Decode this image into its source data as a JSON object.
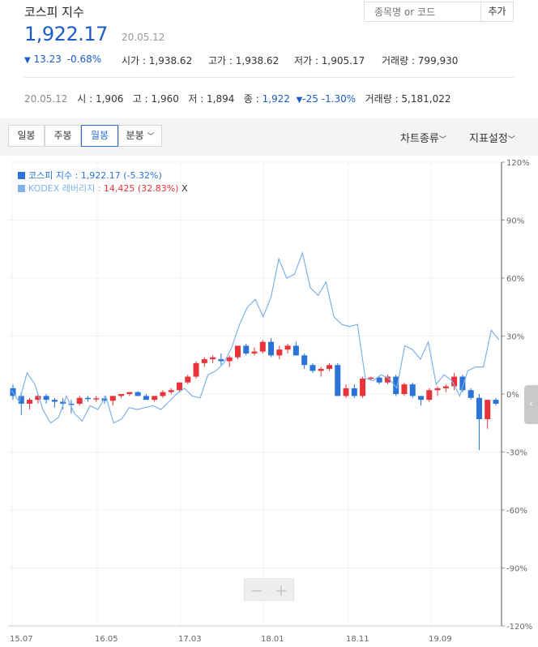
{
  "header": {
    "title": "코스피 지수",
    "price": "1,922.17",
    "date": "20.05.12",
    "change_arrow": "▼",
    "change": "13.23",
    "change_pct": "-0.68%",
    "stats": [
      {
        "label": "시가",
        "value": "1,938.62"
      },
      {
        "label": "고가",
        "value": "1,938.62"
      },
      {
        "label": "저가",
        "value": "1,905.17"
      },
      {
        "label": "거래량",
        "value": "799,930"
      }
    ],
    "search_placeholder": "종목명 or 코드",
    "add_label": "추가"
  },
  "daily": {
    "date": "20.05.12",
    "open_label": "시",
    "open": "1,906",
    "high_label": "고",
    "high": "1,960",
    "low_label": "저",
    "low": "1,894",
    "close_label": "종",
    "close": "1,922",
    "arrow": "▼",
    "change": "-25",
    "change_pct": "-1.30%",
    "volume_label": "거래량",
    "volume": "5,181,022"
  },
  "toolbar": {
    "tabs": [
      "일봉",
      "주봉",
      "월봉",
      "분봉"
    ],
    "selected": "월봉",
    "chart_type": "차트종류",
    "indicator": "지표설정"
  },
  "legend": {
    "s1_name": "코스피 지수",
    "s1_value": "1,922.17",
    "s1_pct": "(-5.32%)",
    "s2_name": "KODEX 레버리지",
    "s2_value": "14,425",
    "s2_pct": "(32.83%)",
    "s2_close": "X"
  },
  "colors": {
    "up": "#e8333a",
    "down": "#2a73d9",
    "line": "#7fb2e8",
    "accent": "#1a5bc6"
  },
  "chart_data": {
    "type": "line",
    "x_ticks": [
      "15.07",
      "16.05",
      "17.03",
      "18.01",
      "18.11",
      "19.09"
    ],
    "y_ticks": [
      "120%",
      "90%",
      "60%",
      "30%",
      "0%",
      "-30%",
      "-60%",
      "-90%",
      "-120%"
    ],
    "ylim": [
      -120,
      120
    ],
    "candles": [
      {
        "o": 3,
        "h": 5,
        "l": -3,
        "c": -1
      },
      {
        "o": -1,
        "h": 1,
        "l": -11,
        "c": -5
      },
      {
        "o": -5,
        "h": -2,
        "l": -8,
        "c": -3
      },
      {
        "o": -3,
        "h": 0,
        "l": -5,
        "c": -1
      },
      {
        "o": -1,
        "h": 0,
        "l": -5,
        "c": -3
      },
      {
        "o": -3,
        "h": -2,
        "l": -7,
        "c": -4
      },
      {
        "o": -4,
        "h": -2,
        "l": -8,
        "c": -5
      },
      {
        "o": -5,
        "h": -3,
        "l": -10,
        "c": -5.5
      },
      {
        "o": -5,
        "h": -1,
        "l": -6,
        "c": -2
      },
      {
        "o": -2,
        "h": -1,
        "l": -4,
        "c": -2.5
      },
      {
        "o": -2.5,
        "h": -1,
        "l": -4,
        "c": -2.2
      },
      {
        "o": -2.2,
        "h": -1,
        "l": -5,
        "c": -3.5
      },
      {
        "o": -3.5,
        "h": -2,
        "l": -6,
        "c": -1
      },
      {
        "o": -1,
        "h": 0,
        "l": -2,
        "c": 0
      },
      {
        "o": 0,
        "h": 1,
        "l": -1,
        "c": 1
      },
      {
        "o": 1,
        "h": 1.5,
        "l": -1,
        "c": -1
      },
      {
        "o": -1,
        "h": 0,
        "l": -3,
        "c": -3
      },
      {
        "o": -3,
        "h": -1,
        "l": -4,
        "c": -1
      },
      {
        "o": -1,
        "h": 2,
        "l": -2,
        "c": 1
      },
      {
        "o": 1,
        "h": 3,
        "l": 0,
        "c": 2
      },
      {
        "o": 2,
        "h": 6,
        "l": 1,
        "c": 6
      },
      {
        "o": 6,
        "h": 10,
        "l": 5,
        "c": 9
      },
      {
        "o": 9,
        "h": 17,
        "l": 8,
        "c": 16
      },
      {
        "o": 16,
        "h": 19,
        "l": 14,
        "c": 18
      },
      {
        "o": 18,
        "h": 20,
        "l": 16,
        "c": 19
      },
      {
        "o": 18,
        "h": 21,
        "l": 15,
        "c": 17
      },
      {
        "o": 17,
        "h": 20,
        "l": 14,
        "c": 19
      },
      {
        "o": 19,
        "h": 25,
        "l": 18,
        "c": 25
      },
      {
        "o": 25,
        "h": 26,
        "l": 20,
        "c": 21
      },
      {
        "o": 21,
        "h": 24,
        "l": 20,
        "c": 22
      },
      {
        "o": 22,
        "h": 28,
        "l": 21,
        "c": 27
      },
      {
        "o": 27,
        "h": 29,
        "l": 19,
        "c": 20
      },
      {
        "o": 20,
        "h": 25,
        "l": 18,
        "c": 23
      },
      {
        "o": 23,
        "h": 26,
        "l": 21,
        "c": 25
      },
      {
        "o": 25,
        "h": 27,
        "l": 20,
        "c": 20
      },
      {
        "o": 20,
        "h": 21,
        "l": 13,
        "c": 15
      },
      {
        "o": 15,
        "h": 16,
        "l": 11,
        "c": 12
      },
      {
        "o": 12,
        "h": 14,
        "l": 9,
        "c": 13
      },
      {
        "o": 13,
        "h": 16,
        "l": 12,
        "c": 15
      },
      {
        "o": 15,
        "h": 16,
        "l": -1,
        "c": -1
      },
      {
        "o": -1,
        "h": 5,
        "l": -2,
        "c": 3
      },
      {
        "o": 3,
        "h": 5,
        "l": -2,
        "c": -1
      },
      {
        "o": -1,
        "h": 9,
        "l": -2,
        "c": 8
      },
      {
        "o": 8,
        "h": 9,
        "l": 7,
        "c": 8.5
      },
      {
        "o": 8.5,
        "h": 9,
        "l": 5,
        "c": 6
      },
      {
        "o": 6,
        "h": 10,
        "l": 5,
        "c": 9
      },
      {
        "o": 9,
        "h": 10,
        "l": -1,
        "c": 0
      },
      {
        "o": 0,
        "h": 6,
        "l": -1,
        "c": 5
      },
      {
        "o": 5,
        "h": 6,
        "l": -2,
        "c": -1
      },
      {
        "o": -1,
        "h": -1,
        "l": -6,
        "c": -3
      },
      {
        "o": -3,
        "h": 3,
        "l": -4,
        "c": 2
      },
      {
        "o": 2,
        "h": 4,
        "l": -1,
        "c": 3
      },
      {
        "o": 3,
        "h": 5,
        "l": 1,
        "c": 4
      },
      {
        "o": 4,
        "h": 11,
        "l": 2,
        "c": 9
      },
      {
        "o": 9,
        "h": 10,
        "l": 1,
        "c": 2
      },
      {
        "o": 2,
        "h": 3,
        "l": -3,
        "c": -2
      },
      {
        "o": -2,
        "h": 0,
        "l": -29,
        "c": -13
      },
      {
        "o": -13,
        "h": -3,
        "l": -18,
        "c": -3
      },
      {
        "o": -3,
        "h": -2,
        "l": -6,
        "c": -5
      }
    ],
    "line_values": [
      2,
      -4,
      11,
      5,
      -8,
      -15,
      -12,
      -1,
      -10,
      -14,
      -6,
      -8,
      -1,
      -15,
      -13,
      -7,
      -8,
      -7,
      -6,
      -8,
      -4,
      0,
      3,
      -1,
      -2,
      10,
      12,
      16,
      24,
      36,
      45,
      49,
      40,
      50,
      70,
      60,
      62,
      73,
      55,
      51,
      58,
      40,
      36,
      35,
      36,
      8,
      7,
      10,
      8,
      3,
      25,
      23,
      18,
      27,
      5,
      10,
      7,
      -1,
      12,
      14,
      14,
      33,
      28
    ]
  }
}
